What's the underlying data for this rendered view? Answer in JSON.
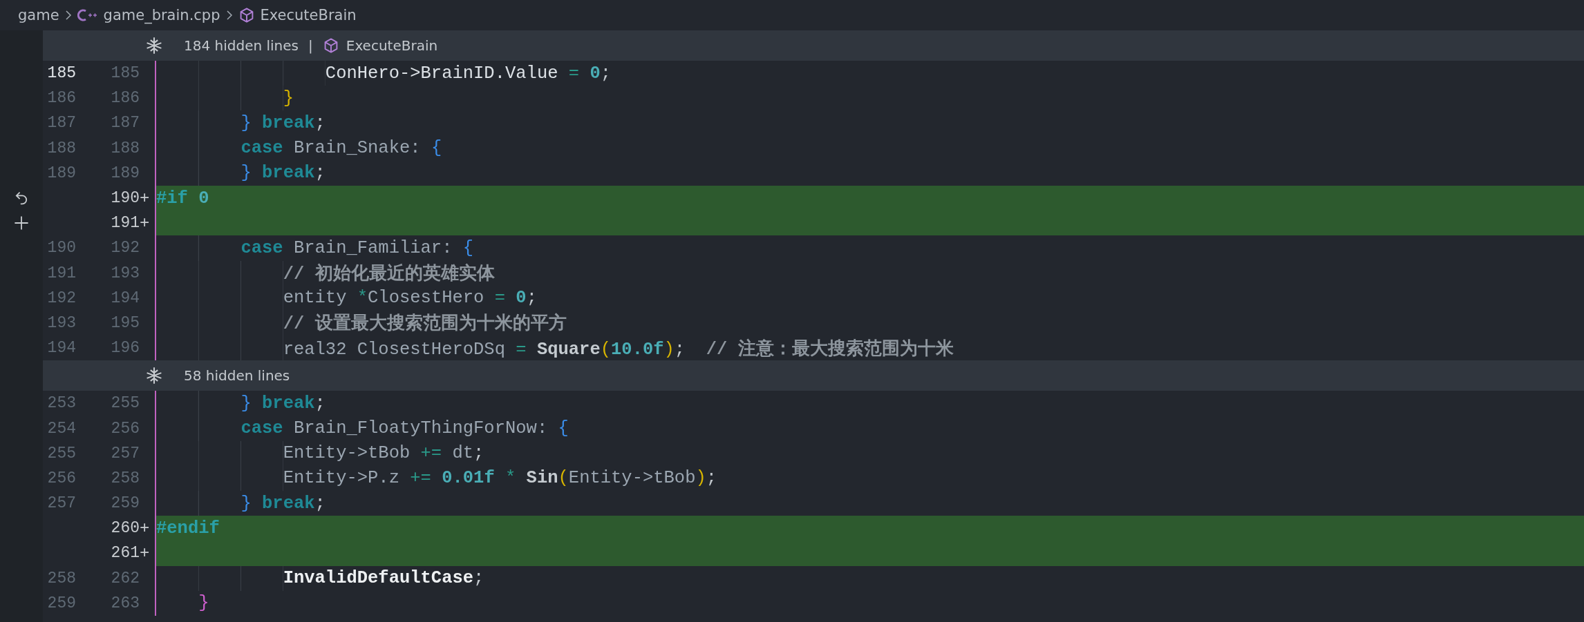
{
  "breadcrumb": {
    "items": [
      {
        "label": "game",
        "kind": "folder"
      },
      {
        "label": "game_brain.cpp",
        "kind": "file"
      },
      {
        "label": "ExecuteBrain",
        "kind": "symbol"
      }
    ]
  },
  "rows": [
    {
      "kind": "fold",
      "text": "184 hidden lines",
      "separator": "|",
      "symbol": "ExecuteBrain"
    },
    {
      "kind": "context",
      "old": "185",
      "new": "185",
      "active": true,
      "code": [
        {
          "kind": "bright",
          "text": "                ConHero->BrainID.Value "
        },
        {
          "kind": "op",
          "text": "="
        },
        {
          "kind": "num",
          "text": " 0"
        },
        {
          "kind": "punct",
          "text": ";"
        }
      ]
    },
    {
      "kind": "context",
      "old": "186",
      "new": "186",
      "code": [
        {
          "kind": "b2",
          "text": "            }"
        }
      ]
    },
    {
      "kind": "context",
      "old": "187",
      "new": "187",
      "code": [
        {
          "kind": "b1",
          "text": "        }"
        },
        {
          "kind": "kw",
          "text": " break"
        },
        {
          "kind": "punct",
          "text": ";"
        }
      ]
    },
    {
      "kind": "context",
      "old": "188",
      "new": "188",
      "code": [
        {
          "kind": "kw",
          "text": "        case"
        },
        {
          "kind": "plain",
          "text": " Brain_Snake: "
        },
        {
          "kind": "b1",
          "text": "{"
        }
      ]
    },
    {
      "kind": "context",
      "old": "189",
      "new": "189",
      "code": [
        {
          "kind": "b1",
          "text": "        }"
        },
        {
          "kind": "kw",
          "text": " break"
        },
        {
          "kind": "punct",
          "text": ";"
        }
      ]
    },
    {
      "kind": "added",
      "new": "190",
      "marker": "+",
      "hovered": true,
      "code": [
        {
          "kind": "pre",
          "text": "#if"
        },
        {
          "kind": "num",
          "text": " 0"
        }
      ]
    },
    {
      "kind": "added",
      "new": "191",
      "marker": "+",
      "hovered": true
    },
    {
      "kind": "context",
      "old": "190",
      "new": "192",
      "code": [
        {
          "kind": "kw",
          "text": "        case"
        },
        {
          "kind": "plain",
          "text": " Brain_Familiar: "
        },
        {
          "kind": "b1",
          "text": "{"
        }
      ]
    },
    {
      "kind": "context",
      "old": "191",
      "new": "193",
      "code": [
        {
          "kind": "comment",
          "text": "            // 初始化最近的英雄实体"
        }
      ]
    },
    {
      "kind": "context",
      "old": "192",
      "new": "194",
      "code": [
        {
          "kind": "plain",
          "text": "            entity "
        },
        {
          "kind": "op",
          "text": "*"
        },
        {
          "kind": "plain",
          "text": "ClosestHero "
        },
        {
          "kind": "op",
          "text": "="
        },
        {
          "kind": "num",
          "text": " 0"
        },
        {
          "kind": "punct",
          "text": ";"
        }
      ]
    },
    {
      "kind": "context",
      "old": "193",
      "new": "195",
      "code": [
        {
          "kind": "comment",
          "text": "            // 设置最大搜索范围为十米的平方"
        }
      ]
    },
    {
      "kind": "context",
      "old": "194",
      "new": "196",
      "code": [
        {
          "kind": "plain",
          "text": "            real32 ClosestHeroDSq "
        },
        {
          "kind": "op",
          "text": "="
        },
        {
          "kind": "func",
          "text": " Square"
        },
        {
          "kind": "b2",
          "text": "("
        },
        {
          "kind": "num",
          "text": "10.0f"
        },
        {
          "kind": "b2",
          "text": ")"
        },
        {
          "kind": "punct",
          "text": ";"
        },
        {
          "kind": "comment",
          "text": "  // 注意：最大搜索范围为十米"
        }
      ]
    },
    {
      "kind": "fold",
      "text": "58 hidden lines"
    },
    {
      "kind": "context",
      "old": "253",
      "new": "255",
      "code": [
        {
          "kind": "b1",
          "text": "        }"
        },
        {
          "kind": "kw",
          "text": " break"
        },
        {
          "kind": "punct",
          "text": ";"
        }
      ]
    },
    {
      "kind": "context",
      "old": "254",
      "new": "256",
      "code": [
        {
          "kind": "kw",
          "text": "        case"
        },
        {
          "kind": "plain",
          "text": " Brain_FloatyThingForNow: "
        },
        {
          "kind": "b1",
          "text": "{"
        }
      ]
    },
    {
      "kind": "context",
      "old": "255",
      "new": "257",
      "code": [
        {
          "kind": "plain",
          "text": "            Entity->tBob "
        },
        {
          "kind": "op",
          "text": "+="
        },
        {
          "kind": "plain",
          "text": " dt"
        },
        {
          "kind": "punct",
          "text": ";"
        }
      ]
    },
    {
      "kind": "context",
      "old": "256",
      "new": "258",
      "code": [
        {
          "kind": "plain",
          "text": "            Entity->P.z "
        },
        {
          "kind": "op",
          "text": "+="
        },
        {
          "kind": "num",
          "text": " 0.01f"
        },
        {
          "kind": "op",
          "text": " *"
        },
        {
          "kind": "func",
          "text": " Sin"
        },
        {
          "kind": "b2",
          "text": "("
        },
        {
          "kind": "plain",
          "text": "Entity->tBob"
        },
        {
          "kind": "b2",
          "text": ")"
        },
        {
          "kind": "punct",
          "text": ";"
        }
      ]
    },
    {
      "kind": "context",
      "old": "257",
      "new": "259",
      "code": [
        {
          "kind": "b1",
          "text": "        }"
        },
        {
          "kind": "kw",
          "text": " break"
        },
        {
          "kind": "punct",
          "text": ";"
        }
      ]
    },
    {
      "kind": "added",
      "new": "260",
      "marker": "+",
      "code": [
        {
          "kind": "pre",
          "text": "#endif"
        }
      ]
    },
    {
      "kind": "added",
      "new": "261",
      "marker": "+"
    },
    {
      "kind": "context",
      "old": "258",
      "new": "262",
      "code": [
        {
          "kind": "strong",
          "text": "            InvalidDefaultCase"
        },
        {
          "kind": "punct",
          "text": ";"
        }
      ]
    },
    {
      "kind": "context",
      "old": "259",
      "new": "263",
      "code": [
        {
          "kind": "b3",
          "text": "    }"
        }
      ]
    }
  ]
}
